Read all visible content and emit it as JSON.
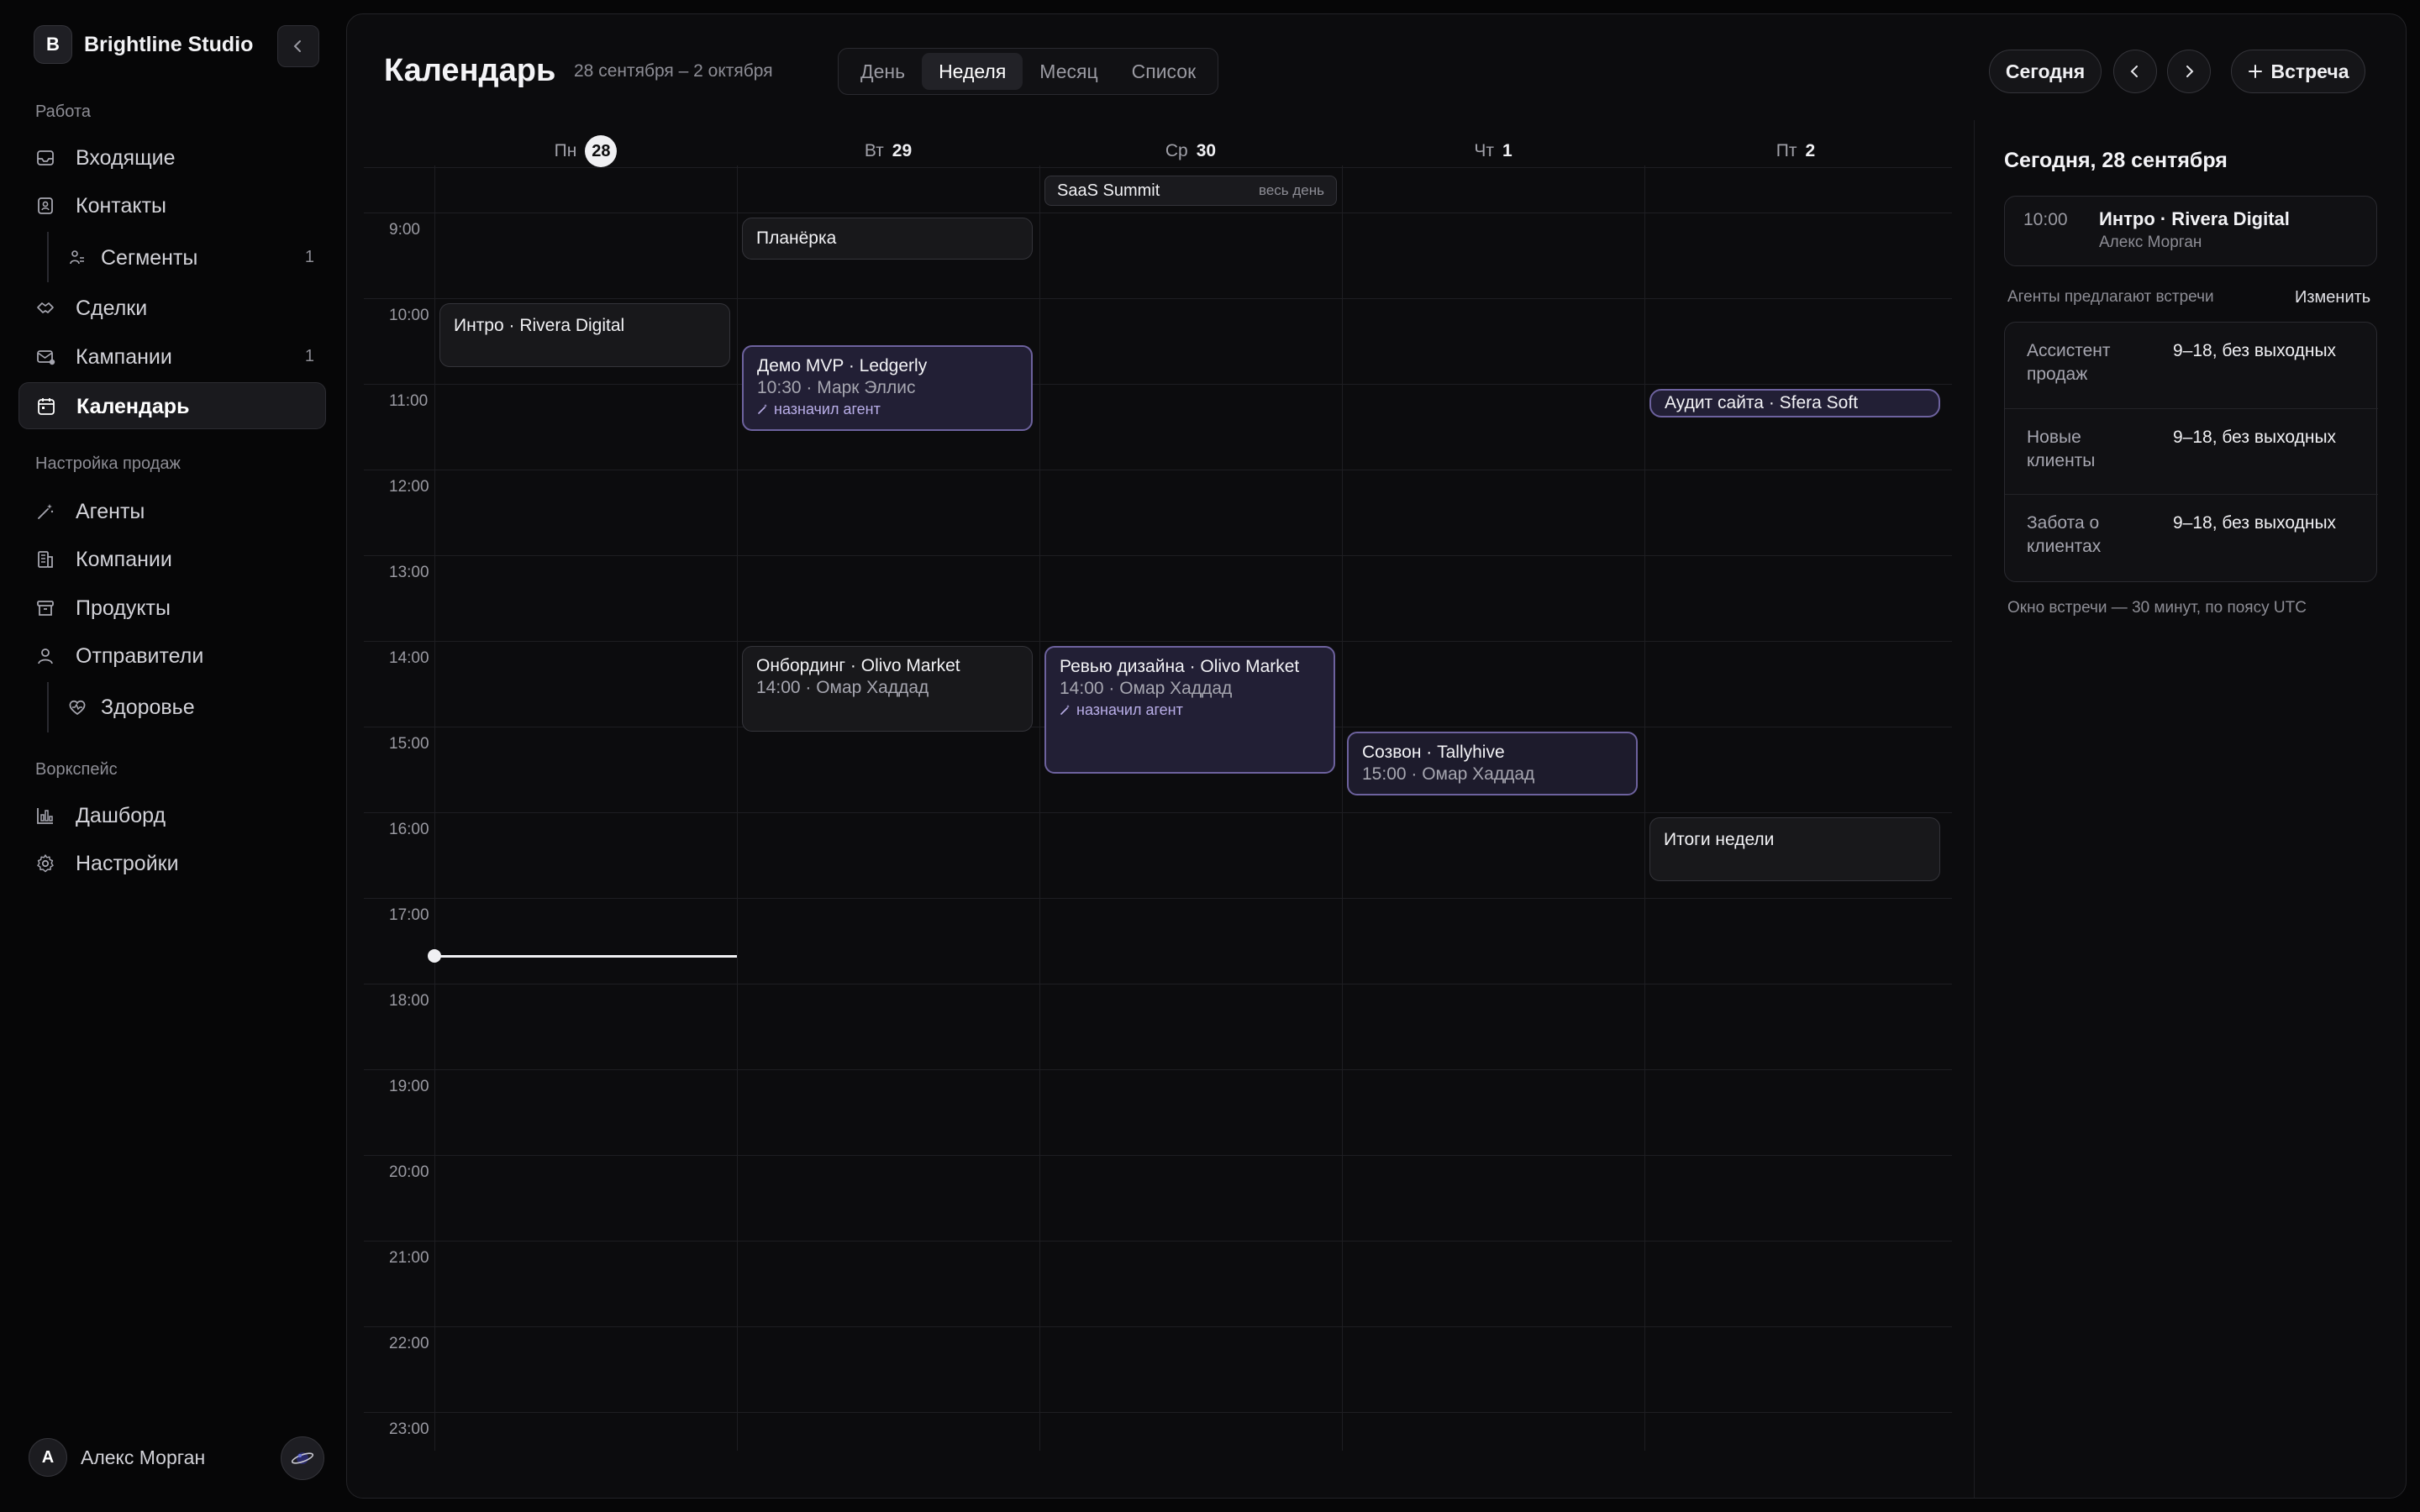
{
  "brand": {
    "logo_letter": "B",
    "name": "Brightline Studio"
  },
  "sidebar": {
    "sections": [
      {
        "title": "Работа"
      },
      {
        "title": "Настройка продаж"
      },
      {
        "title": "Воркспейс"
      }
    ],
    "items": [
      {
        "label": "Входящие",
        "icon": "inbox-icon"
      },
      {
        "label": "Контакты",
        "icon": "contacts-icon"
      },
      {
        "label": "Сегменты",
        "icon": "segments-icon",
        "count": "1"
      },
      {
        "label": "Сделки",
        "icon": "handshake-icon"
      },
      {
        "label": "Кампании",
        "icon": "campaign-icon",
        "count": "1"
      },
      {
        "label": "Календарь",
        "icon": "calendar-icon",
        "active": true
      },
      {
        "label": "Агенты",
        "icon": "wand-icon"
      },
      {
        "label": "Компании",
        "icon": "building-icon"
      },
      {
        "label": "Продукты",
        "icon": "box-icon"
      },
      {
        "label": "Отправители",
        "icon": "user-icon"
      },
      {
        "label": "Здоровье",
        "icon": "heart-pulse-icon"
      },
      {
        "label": "Дашборд",
        "icon": "chart-icon"
      },
      {
        "label": "Настройки",
        "icon": "gear-icon"
      }
    ]
  },
  "user": {
    "initial": "A",
    "name": "Алекс Морган"
  },
  "header": {
    "title": "Календарь",
    "date_range": "28 сентября – 2 октября",
    "views": [
      "День",
      "Неделя",
      "Месяц",
      "Список"
    ],
    "active_view": "Неделя",
    "today_label": "Сегодня",
    "new_meeting_label": "Встреча"
  },
  "calendar": {
    "days": [
      {
        "name": "Пн",
        "num": "28",
        "today": true
      },
      {
        "name": "Вт",
        "num": "29"
      },
      {
        "name": "Ср",
        "num": "30"
      },
      {
        "name": "Чт",
        "num": "1"
      },
      {
        "name": "Пт",
        "num": "2"
      }
    ],
    "hours": [
      "9:00",
      "10:00",
      "11:00",
      "12:00",
      "13:00",
      "14:00",
      "15:00",
      "16:00",
      "17:00",
      "18:00",
      "19:00",
      "20:00",
      "21:00",
      "22:00",
      "23:00"
    ],
    "allday": {
      "title": "SaaS Summit",
      "tag": "весь день"
    },
    "events": [
      {
        "title": "Планёрка"
      },
      {
        "title": "Интро · Rivera Digital"
      },
      {
        "title": "Демо MVP · Ledgerly",
        "sub": "10:30 · Марк Эллис",
        "agent": "назначил агент"
      },
      {
        "title": "Аудит сайта · Sfera Soft"
      },
      {
        "title": "Онбординг · Olivo Market",
        "sub": "14:00 · Омар Хаддад"
      },
      {
        "title": "Ревью дизайна · Olivo Market",
        "sub": "14:00 · Омар Хаддад",
        "agent": "назначил агент"
      },
      {
        "title": "Созвон · Tallyhive",
        "sub": "15:00 · Омар Хаддад"
      },
      {
        "title": "Итоги недели"
      }
    ]
  },
  "right_panel": {
    "title": "Сегодня, 28 сентября",
    "today_event": {
      "time": "10:00",
      "title": "Интро · Rivera Digital",
      "sub": "Алекс Морган"
    },
    "agents_label": "Агенты предлагают встречи",
    "edit_label": "Изменить",
    "agents": [
      {
        "name": "Ассистент продаж",
        "hours": "9–18, без выходных"
      },
      {
        "name": "Новые клиенты",
        "hours": "9–18, без выходных"
      },
      {
        "name": "Забота о клиентах",
        "hours": "9–18, без выходных"
      }
    ],
    "note": "Окно встречи — 30 минут, по поясу UTC"
  }
}
